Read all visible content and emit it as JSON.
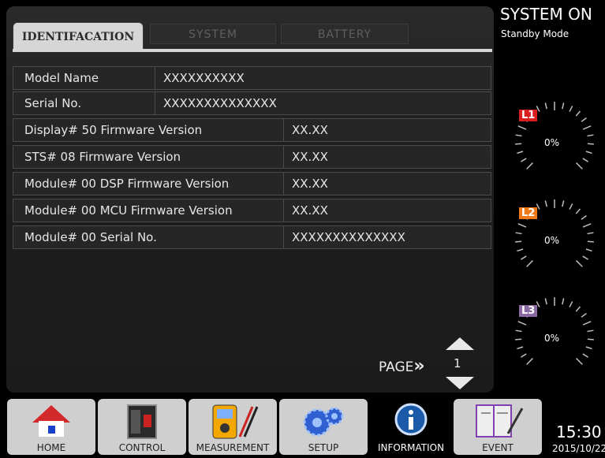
{
  "tabs": [
    {
      "label": "IDENTIFACATION",
      "active": true
    },
    {
      "label": "SYSTEM",
      "active": false
    },
    {
      "label": "BATTERY",
      "active": false
    }
  ],
  "rows": [
    {
      "label": "Model Name",
      "value": "XXXXXXXXXX"
    },
    {
      "label": "Serial No.",
      "value": "XXXXXXXXXXXXXX"
    },
    {
      "label": "Display# 50   Firmware Version",
      "value": "XX.XX"
    },
    {
      "label": "STS# 08   Firmware Version",
      "value": "XX.XX"
    },
    {
      "label": "Module# 00   DSP Firmware Version",
      "value": "XX.XX"
    },
    {
      "label": "Module# 00   MCU Firmware Version",
      "value": "XX.XX"
    },
    {
      "label": "Module# 00   Serial No.",
      "value": "XXXXXXXXXXXXXX"
    }
  ],
  "pager": {
    "label": "PAGE",
    "chevrons": "»",
    "number": "1"
  },
  "status": {
    "title": "SYSTEM ON",
    "mode": "Standby Mode"
  },
  "gauges": [
    {
      "label": "L1",
      "value": "0%",
      "color": "#d81e1e"
    },
    {
      "label": "L2",
      "value": "0%",
      "color": "#f07a1a"
    },
    {
      "label": "L3",
      "value": "0%",
      "color": "#8a6aa0"
    }
  ],
  "nav": [
    {
      "label": "HOME",
      "icon": "home-icon"
    },
    {
      "label": "CONTROL",
      "icon": "control-panel-icon"
    },
    {
      "label": "MEASUREMENT",
      "icon": "multimeter-icon"
    },
    {
      "label": "SETUP",
      "icon": "gears-icon"
    },
    {
      "label": "INFORMATION",
      "icon": "info-icon",
      "active": true
    },
    {
      "label": "EVENT",
      "icon": "event-log-icon"
    }
  ],
  "clock": {
    "time": "15:30",
    "date": "2015/10/22"
  }
}
